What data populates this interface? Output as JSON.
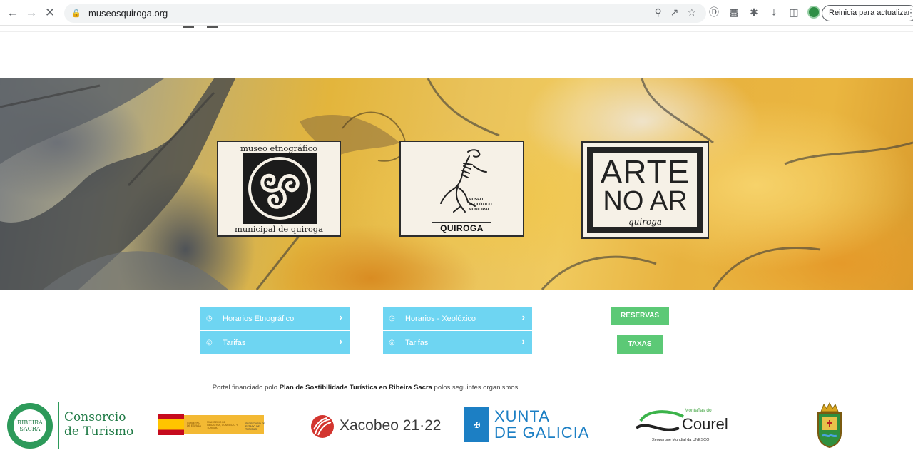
{
  "browser": {
    "url": "museosquiroga.org",
    "update_button": "Reinicia para actualizar"
  },
  "hero": {
    "card1": {
      "top": "museo etnográfico",
      "bottom": "municipal de quiroga"
    },
    "card2": {
      "small_lines": [
        "MUSEO",
        "XEOLÓXICO",
        "MUNICIPAL"
      ],
      "big": "QUIROGA"
    },
    "card3": {
      "line1": "ARTE",
      "line2": "NO AR",
      "line3": "quiroga"
    }
  },
  "links": {
    "etno_hours": "Horarios Etnográfico",
    "etno_fees": "Tarifas",
    "xeo_hours": "Horarios - Xeolóxico",
    "xeo_fees": "Tarifas"
  },
  "buttons": {
    "reservas": "RESERVAS",
    "taxas": "TAXAS"
  },
  "funding": {
    "prefix": "Portal financiado polo ",
    "bold": "Plan de Sostibilidade Turística en Ribeira Sacra",
    "suffix": " polos seguintes organismos"
  },
  "sponsors": {
    "consorcio": {
      "badge": "RIBEIRA SACRA",
      "line1": "Consorcio",
      "line2": "de Turismo"
    },
    "gobierno": {
      "gov": "GOBIERNO DE ESPAÑA",
      "ministry": "MINISTERIO DE INDUSTRIA, COMERCIO Y TURISMO",
      "secretary": "SECRETARÍA DE ESTADO DE TURISMO"
    },
    "xacobeo": {
      "text": "Xacobeo 21·22"
    },
    "xunta": {
      "line1": "XUNTA",
      "line2": "DE GALICIA"
    },
    "courel": {
      "top": "Montañas do",
      "word": "Courel",
      "bottom": "Xeoparque Mundial da UNESCO"
    }
  },
  "colors": {
    "link_blue": "#6ed5f2",
    "button_green": "#5cc976",
    "xunta_blue": "#1c7fc4",
    "consorcio_green": "#2d9a5a"
  }
}
